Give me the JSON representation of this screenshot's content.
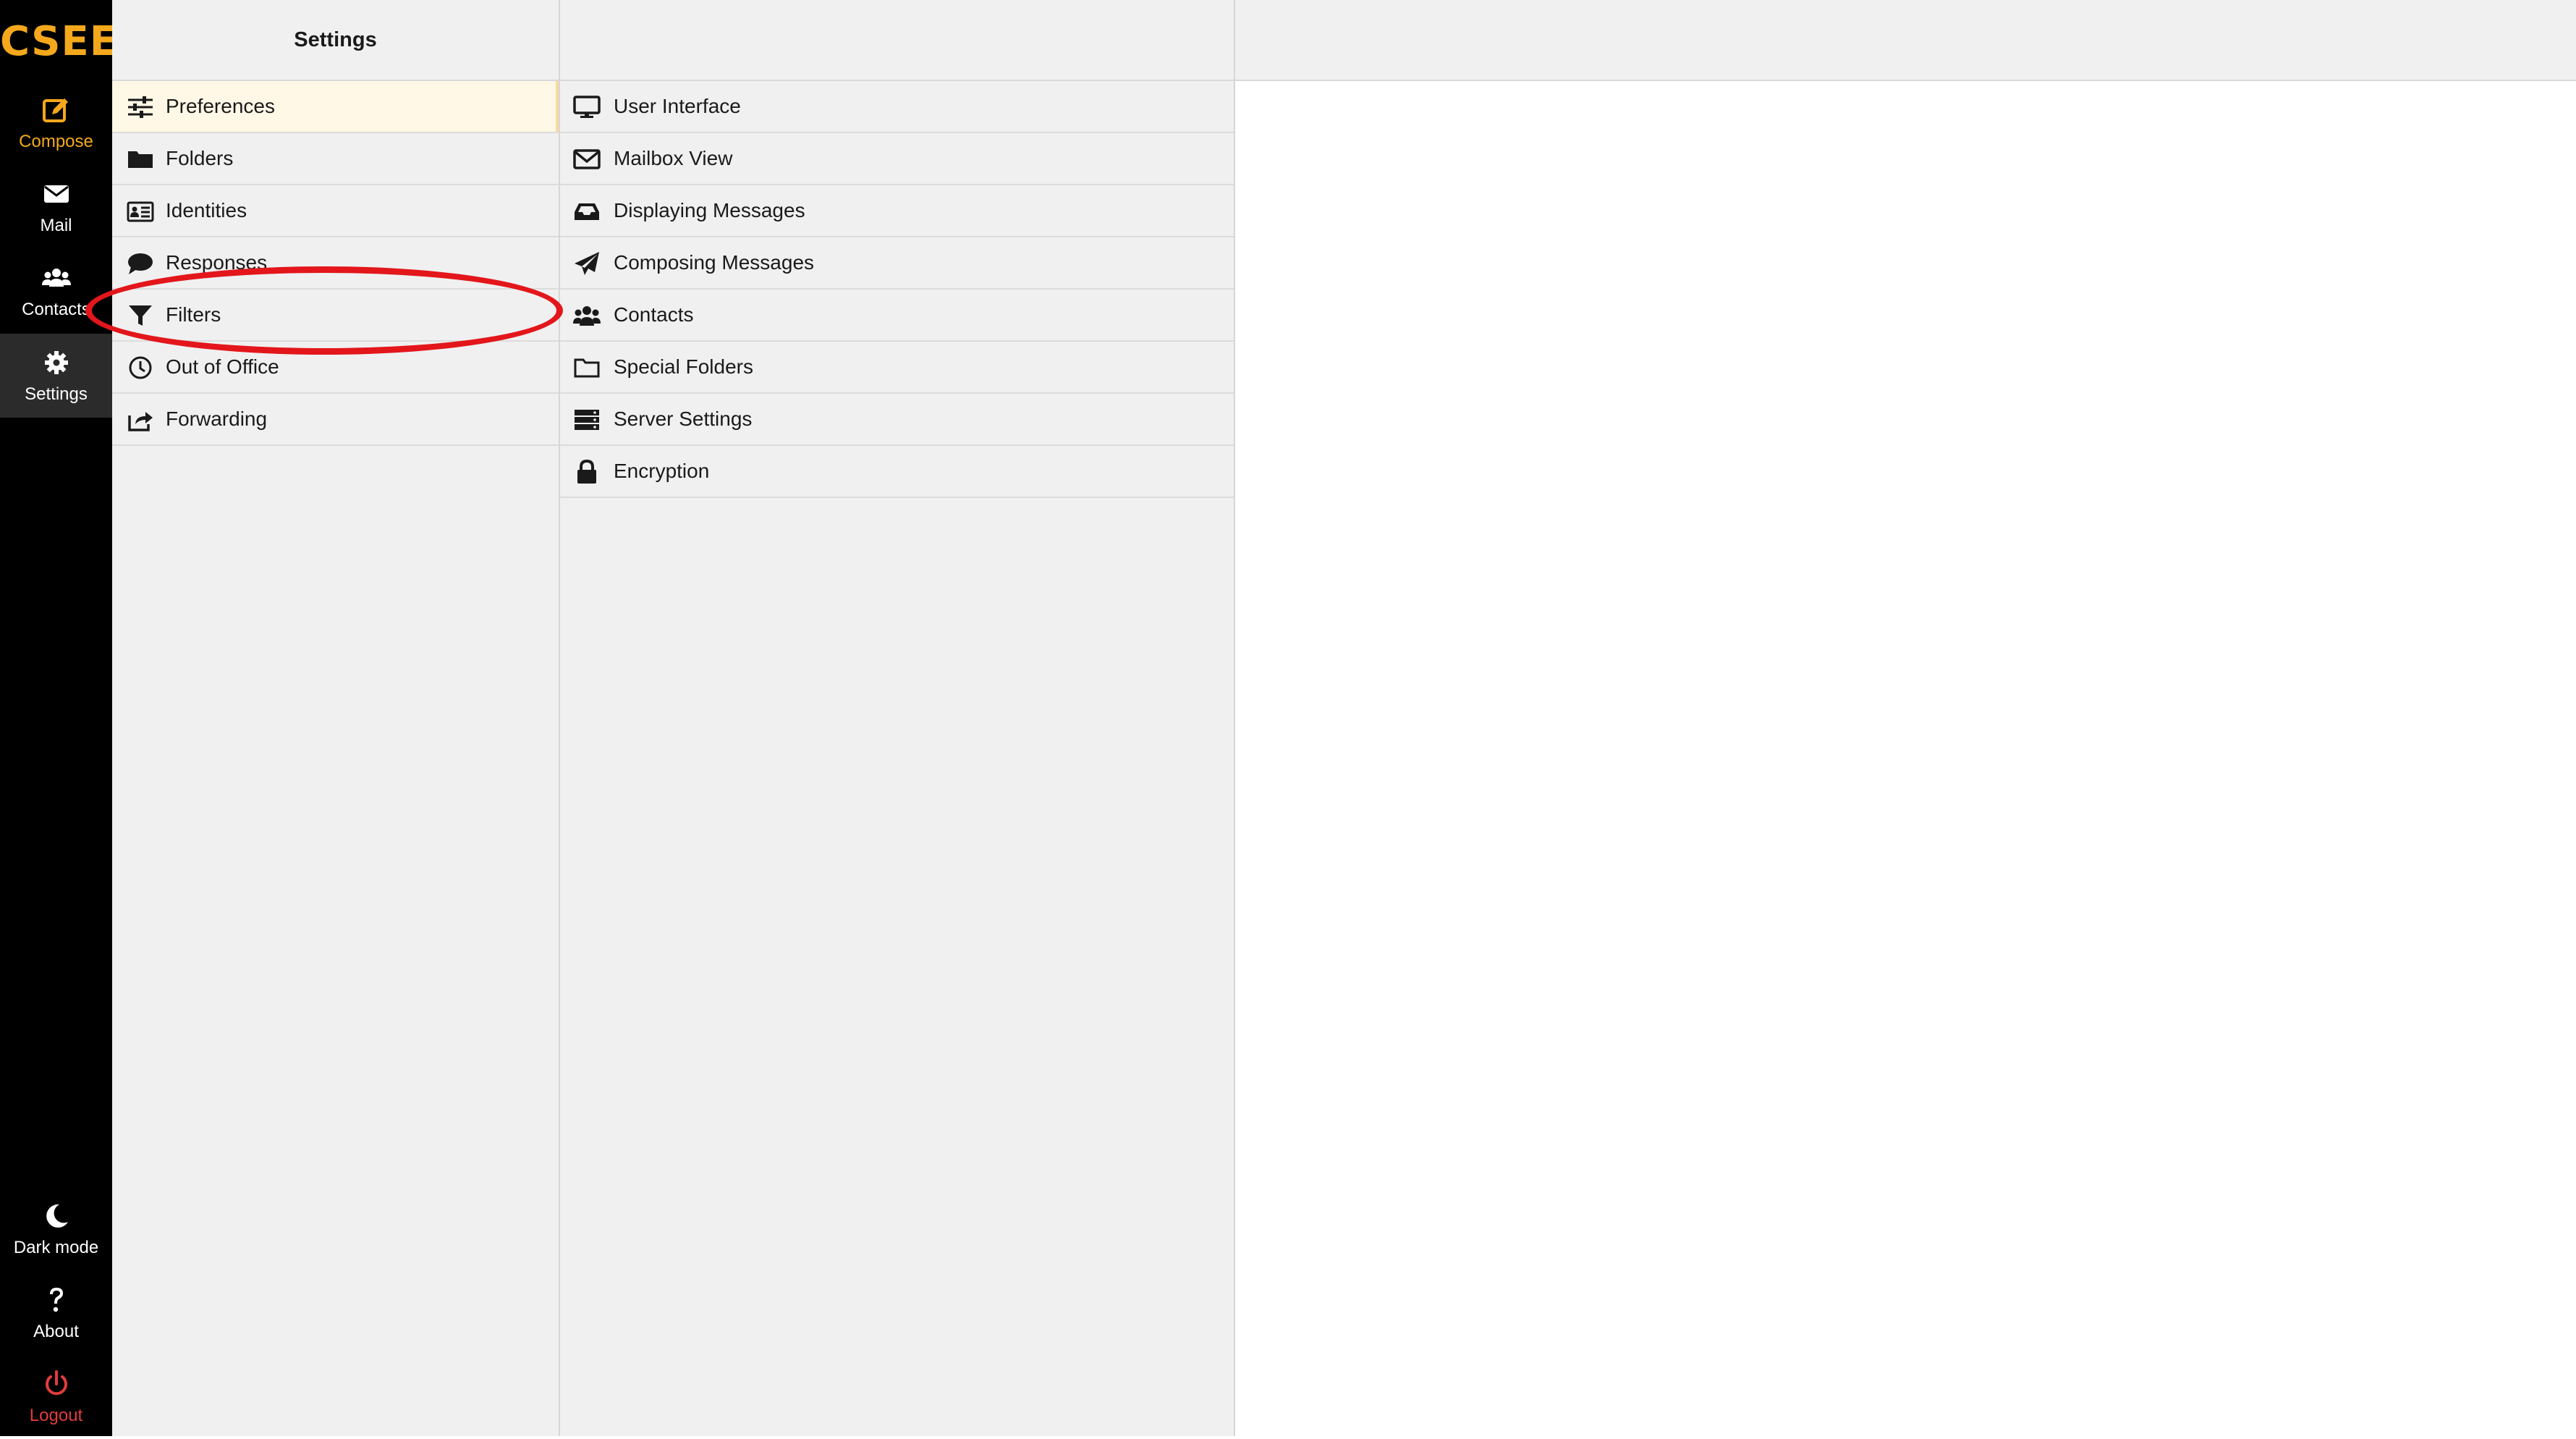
{
  "app": {
    "logo": "CSEE"
  },
  "rail": {
    "compose": "Compose",
    "mail": "Mail",
    "contacts": "Contacts",
    "settings": "Settings",
    "dark_mode": "Dark mode",
    "about": "About",
    "logout": "Logout"
  },
  "settings_column": {
    "title": "Settings",
    "items": [
      {
        "label": "Preferences",
        "icon": "sliders-icon",
        "selected": true
      },
      {
        "label": "Folders",
        "icon": "folder-icon"
      },
      {
        "label": "Identities",
        "icon": "id-card-icon"
      },
      {
        "label": "Responses",
        "icon": "comment-icon"
      },
      {
        "label": "Filters",
        "icon": "filter-icon"
      },
      {
        "label": "Out of Office",
        "icon": "clock-icon"
      },
      {
        "label": "Forwarding",
        "icon": "share-icon"
      }
    ]
  },
  "sections_column": {
    "items": [
      {
        "label": "User Interface",
        "icon": "monitor-icon"
      },
      {
        "label": "Mailbox View",
        "icon": "envelope-icon"
      },
      {
        "label": "Displaying Messages",
        "icon": "inbox-icon"
      },
      {
        "label": "Composing Messages",
        "icon": "paper-plane-icon"
      },
      {
        "label": "Contacts",
        "icon": "users-icon"
      },
      {
        "label": "Special Folders",
        "icon": "folder-outline-icon"
      },
      {
        "label": "Server Settings",
        "icon": "server-icon"
      },
      {
        "label": "Encryption",
        "icon": "lock-icon"
      }
    ]
  },
  "colors": {
    "accent": "#f5a81c",
    "logout": "#e23c3c",
    "annotation": "#e3161b",
    "selected_row": "#fff8e6"
  }
}
